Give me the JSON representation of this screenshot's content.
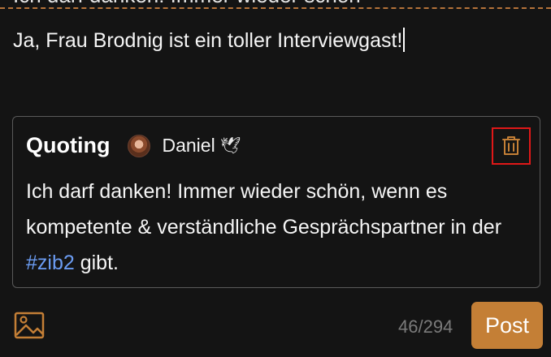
{
  "previous_line": {
    "text": "Ich darf danken! Immer wieder schön"
  },
  "compose": {
    "text": "Ja, Frau Brodnig ist ein toller Interviewgast!"
  },
  "quote": {
    "label": "Quoting",
    "author": "Daniel",
    "author_badge": "🕊",
    "body_start": "Ich darf danken! Immer wieder schön, wenn es kompetente & verständliche Gesprächspartner in der ",
    "hashtag": "#zib2",
    "body_end": " gibt."
  },
  "footer": {
    "counter": "46/294",
    "post_label": "Post"
  },
  "icons": {
    "trash": "trash-icon",
    "image": "image-icon"
  },
  "colors": {
    "background": "#141414",
    "accent": "#c47f36",
    "hashtag": "#6b9cf2",
    "highlight_border": "#e01818",
    "dashed_separator": "#b5733a"
  }
}
